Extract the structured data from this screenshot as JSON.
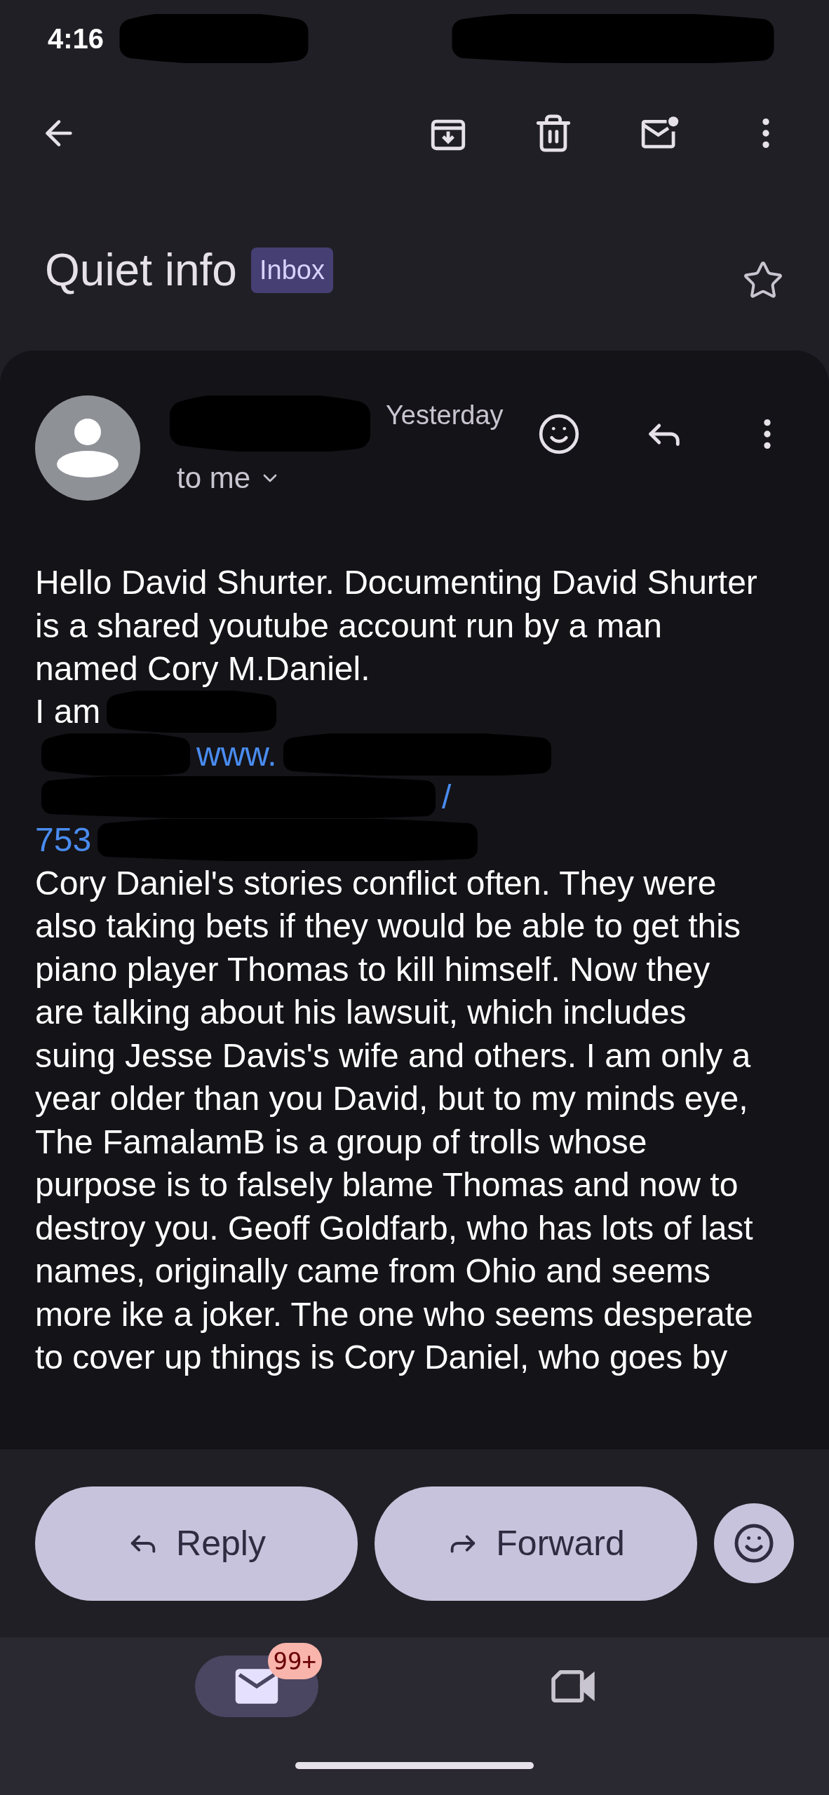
{
  "status_bar": {
    "time": "4:16"
  },
  "subject": {
    "title": "Quiet info",
    "label": "Inbox",
    "starred": false
  },
  "message": {
    "date": "Yesterday",
    "recipient": "to me",
    "body": [
      {
        "kind": "paragraph",
        "text": "Hello David Shurter. Documenting David Shurter is a shared youtube account run by a man named Cory M.Daniel."
      },
      {
        "kind": "redacted_tail",
        "text": "I am"
      },
      {
        "kind": "link",
        "text": "www.",
        "redacted_before": true,
        "redacted_after": true
      },
      {
        "kind": "link",
        "text": "/",
        "redacted_before": true,
        "redacted_after": false
      },
      {
        "kind": "link",
        "text": "753",
        "redacted_before": false,
        "redacted_after": true
      },
      {
        "kind": "paragraph",
        "text": "Cory Daniel's stories conflict often. They were also taking bets if they would be able to get this piano player Thomas to kill himself. Now they are talking about his lawsuit, which includes suing Jesse Davis's wife and others. I am only a year older than you David, but to my minds eye, The FamalamB is a group of trolls whose purpose is to falsely blame Thomas and now to destroy you. Geoff Goldfarb, who has lots of last names, originally came from Ohio and seems more ike a joker. The one who seems desperate to cover up things is Cory Daniel, who goes by"
      }
    ]
  },
  "actions": [
    {
      "kind": "reply",
      "label": "Reply"
    },
    {
      "kind": "forward",
      "label": "Forward"
    }
  ],
  "nav": [
    {
      "kind": "mail",
      "selected": true,
      "badge": "99+"
    },
    {
      "kind": "meet",
      "selected": false
    }
  ]
}
